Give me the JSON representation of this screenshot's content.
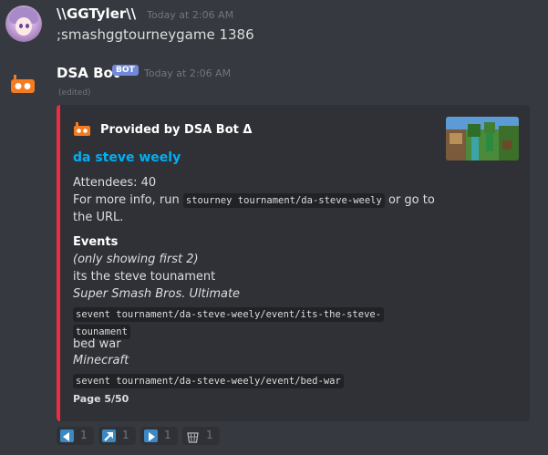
{
  "message1": {
    "author": "\\\\GGTyler\\\\",
    "timestamp": "Today at 2:06 AM",
    "content": ";smashggtourneygame 1386"
  },
  "message2": {
    "author": "DSA Bot",
    "bot_tag": "BOT",
    "timestamp": "Today at 2:06 AM",
    "edited": "(edited)"
  },
  "embed": {
    "accent_color": "#ef2a41",
    "author": "Provided by DSA Bot Δ",
    "title": "da steve weely",
    "attendees": "Attendees: 40",
    "info_prefix": "For more info, run",
    "info_code": "stourney tournament/da-steve-weely",
    "info_suffix": "or go to",
    "info_line2": "the URL.",
    "field_name": "Events",
    "showing_note": "(only showing first 2)",
    "events": [
      {
        "name": "its the steve tounament",
        "game": "Super Smash Bros. Ultimate",
        "command_line1": "sevent tournament/da-steve-weely/event/its-the-steve-",
        "command_line2": "tounament"
      },
      {
        "name": "bed war",
        "game": "Minecraft",
        "command_line1": "sevent tournament/da-steve-weely/event/bed-war"
      }
    ],
    "footer": "Page 5/50"
  },
  "reactions": [
    {
      "icon": "arrow-left-icon",
      "count": "1"
    },
    {
      "icon": "arrow-up-right-icon",
      "count": "1"
    },
    {
      "icon": "arrow-right-icon",
      "count": "1"
    },
    {
      "icon": "wastebasket-icon",
      "count": "1"
    }
  ]
}
